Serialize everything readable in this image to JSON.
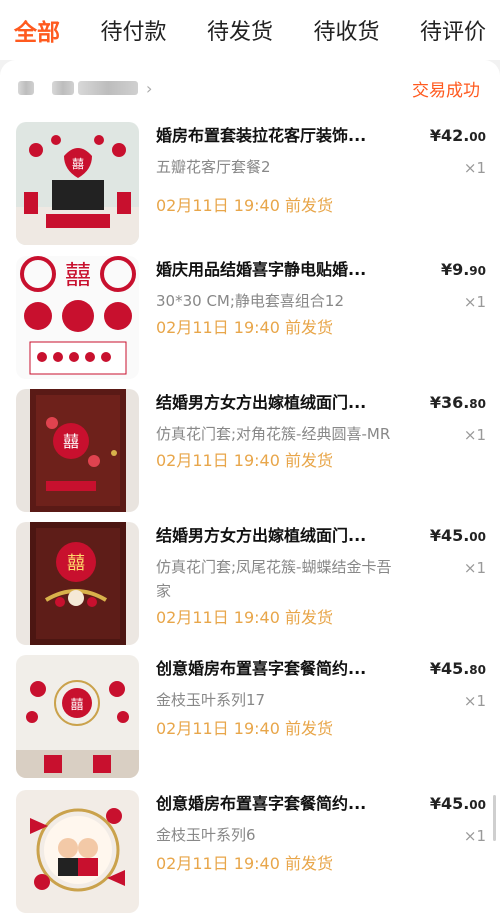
{
  "tabs": [
    {
      "label": "全部",
      "active": true
    },
    {
      "label": "待付款"
    },
    {
      "label": "待发货"
    },
    {
      "label": "待收货"
    },
    {
      "label": "待评价"
    }
  ],
  "shop": {
    "status": "交易成功"
  },
  "items": [
    {
      "title": "婚房布置套装拉花客厅装饰...",
      "spec": "五瓣花客厅套餐2",
      "ship": "02月11日 19:40 前发货",
      "price_int": "¥42.",
      "price_dec": "00",
      "qty": "×1"
    },
    {
      "title": "婚庆用品结婚喜字静电贴婚...",
      "spec": "30*30 CM;静电套喜组合12",
      "ship": "02月11日 19:40 前发货",
      "price_int": "¥9.",
      "price_dec": "90",
      "qty": "×1"
    },
    {
      "title": "结婚男方女方出嫁植绒面门...",
      "spec": "仿真花门套;对角花簇-经典圆喜-MR",
      "ship": "02月11日 19:40 前发货",
      "price_int": "¥36.",
      "price_dec": "80",
      "qty": "×1"
    },
    {
      "title": "结婚男方女方出嫁植绒面门...",
      "spec": "仿真花门套;凤尾花簇-蝴蝶结金卡吾家",
      "ship": "02月11日 19:40 前发货",
      "price_int": "¥45.",
      "price_dec": "00",
      "qty": "×1"
    },
    {
      "title": "创意婚房布置喜字套餐简约...",
      "spec": "金枝玉叶系列17",
      "ship": "02月11日 19:40 前发货",
      "price_int": "¥45.",
      "price_dec": "80",
      "qty": "×1"
    },
    {
      "title": "创意婚房布置喜字套餐简约...",
      "spec": "金枝玉叶系列6",
      "ship": "02月11日 19:40 前发货",
      "price_int": "¥45.",
      "price_dec": "00",
      "qty": "×1"
    }
  ],
  "colors": {
    "accent": "#ff5a1f",
    "ship": "#e8a64a",
    "red": "#c8102e"
  }
}
